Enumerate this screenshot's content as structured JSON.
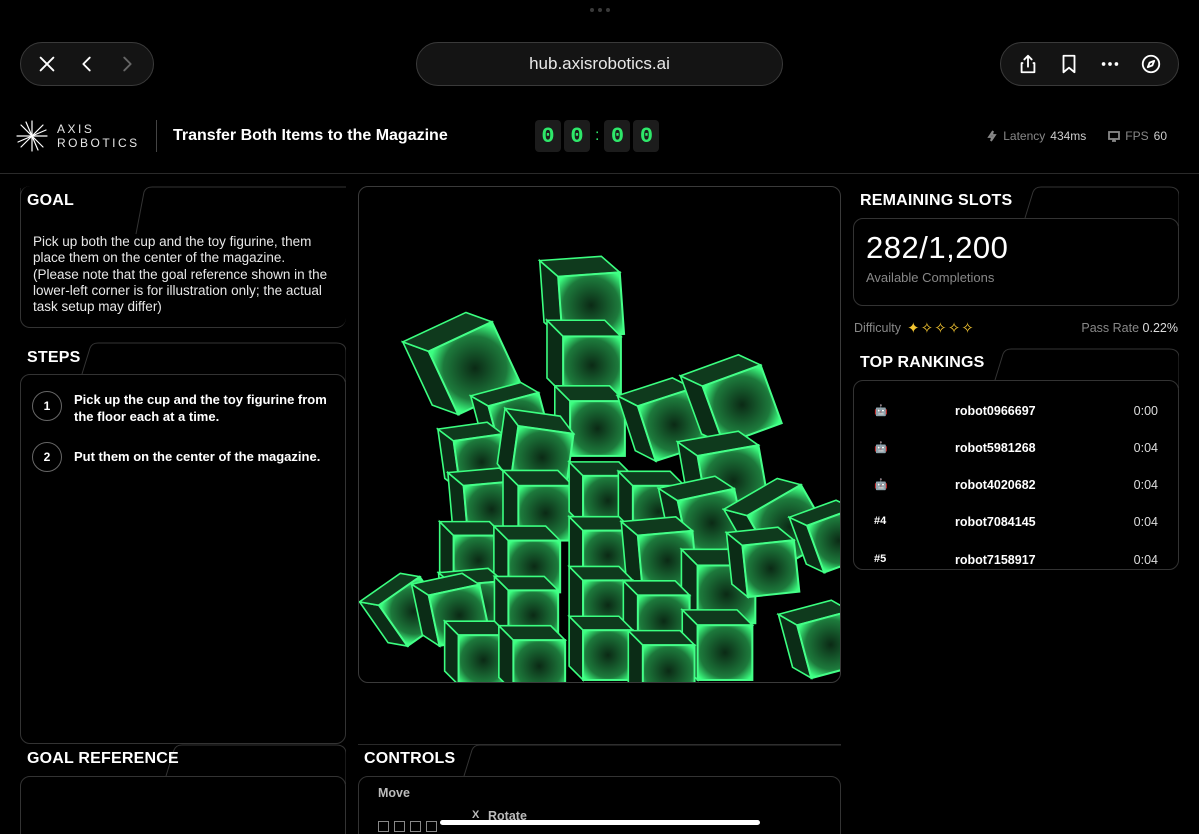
{
  "browser": {
    "url": "hub.axisrobotics.ai",
    "nav_icons": [
      "close-icon",
      "back-icon",
      "forward-icon"
    ],
    "action_icons": [
      "share-icon",
      "bookmark-icon",
      "more-icon",
      "compass-icon"
    ]
  },
  "header": {
    "brand_line1": "AXIS",
    "brand_line2": "ROBOTICS",
    "task_title": "Transfer Both Items to the Magazine",
    "timer": [
      "0",
      "0",
      "0",
      "0"
    ],
    "timer_separator": ":",
    "latency_label": "Latency",
    "latency_value": "434ms",
    "fps_label": "FPS",
    "fps_value": "60"
  },
  "goal": {
    "title": "GOAL",
    "text": "Pick up both the cup and the toy figurine, them place them on the center of the magazine. (Please note that the goal reference shown in the lower-left corner is for illustration only; the actual task setup may differ)"
  },
  "steps": {
    "title": "STEPS",
    "items": [
      {
        "num": "1",
        "text": "Pick up the cup and the toy figurine from the floor each at a time."
      },
      {
        "num": "2",
        "text": "Put them on the center of the magazine."
      }
    ]
  },
  "remaining": {
    "title": "REMAINING SLOTS",
    "count": "282/1,200",
    "subtitle": "Available Completions",
    "difficulty_label": "Difficulty",
    "difficulty_stars": "✦✧✧✧✧",
    "difficulty_level": 1,
    "difficulty_max": 5,
    "pass_rate_label": "Pass Rate",
    "pass_rate_value": "0.22%"
  },
  "rankings": {
    "title": "TOP RANKINGS",
    "rows": [
      {
        "badge": "🤖",
        "badge_color": "#9b6bd6",
        "name": "robot0966697",
        "time": "0:00"
      },
      {
        "badge": "🤖",
        "badge_color": "#8b5fd0",
        "name": "robot5981268",
        "time": "0:04"
      },
      {
        "badge": "🤖",
        "badge_color": "#e0703a",
        "name": "robot4020682",
        "time": "0:04"
      },
      {
        "badge": "#4",
        "badge_color": "#ffffff",
        "name": "robot7084145",
        "time": "0:04"
      },
      {
        "badge": "#5",
        "badge_color": "#ffffff",
        "name": "robot7158917",
        "time": "0:04"
      }
    ]
  },
  "goal_reference": {
    "title": "GOAL REFERENCE"
  },
  "controls": {
    "title": "CONTROLS",
    "move_label": "Move",
    "rotate_key": "X",
    "rotate_label": "Rotate"
  },
  "colors": {
    "accent_green": "#2ee86a",
    "cube_edge": "#38ff7a",
    "star": "#f3c531"
  }
}
